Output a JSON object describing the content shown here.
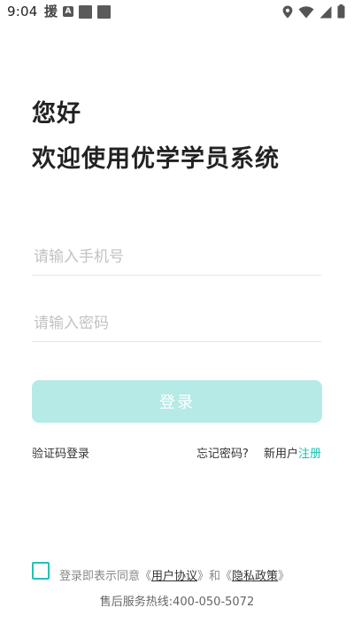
{
  "status_bar": {
    "time": "9:04",
    "notif_char": "援",
    "notif_a": "A"
  },
  "greeting": {
    "hello": "您好",
    "welcome": "欢迎使用优学学员系统"
  },
  "form": {
    "phone_placeholder": "请输入手机号",
    "password_placeholder": "请输入密码",
    "login_label": "登录"
  },
  "links": {
    "sms_login": "验证码登录",
    "forgot_password": "忘记密码?",
    "new_user": "新用户",
    "register": "注册"
  },
  "agreement": {
    "prefix": "登录即表示同意《",
    "user_agreement": "用户协议",
    "middle": "》和《",
    "privacy_policy": "隐私政策",
    "suffix": "》"
  },
  "footer": {
    "hotline": "售后服务热线:400-050-5072"
  },
  "colors": {
    "accent": "#1ec0b0",
    "button_disabled": "#b6eae6"
  }
}
